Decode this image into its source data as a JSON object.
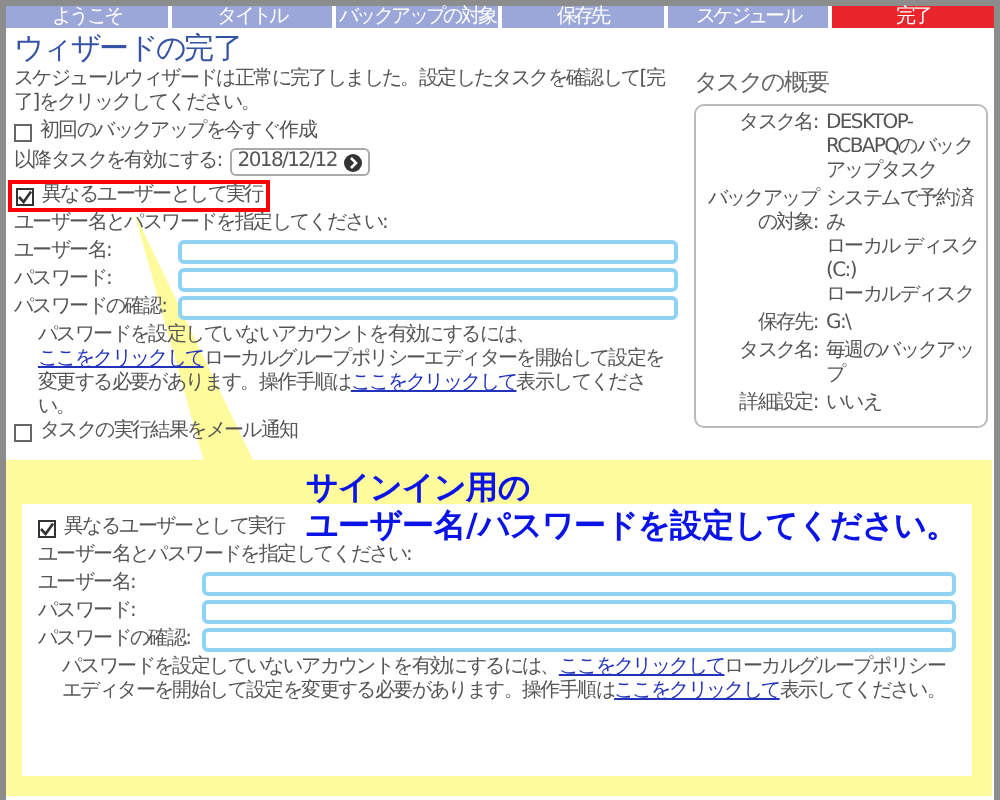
{
  "tabs": [
    {
      "label": "ようこそ",
      "selected": false
    },
    {
      "label": "タイトル",
      "selected": false
    },
    {
      "label": "バックアップの対象",
      "selected": false
    },
    {
      "label": "保存先",
      "selected": false
    },
    {
      "label": "スケジュール",
      "selected": false
    },
    {
      "label": "完了",
      "selected": true
    }
  ],
  "title": "ウィザードの完了",
  "intro": "スケジュールウィザードは正常に完了しました。設定したタスクを確認して[完了]をクリックしてください。",
  "backup_now": {
    "label": "初回のバックアップを今すぐ作成",
    "checked": false
  },
  "enable_after": {
    "label": "以降タスクを有効にする:",
    "value": "2018/12/12"
  },
  "run_as": {
    "label": "異なるユーザーとして実行",
    "checked": true,
    "highlighted": true
  },
  "hint": "ユーザー名とパスワードを指定してください:",
  "fields": [
    {
      "label": "ユーザー名:"
    },
    {
      "label": "パスワード:"
    },
    {
      "label": "パスワードの確認:"
    }
  ],
  "note": [
    {
      "text": "パスワードを設定していないアカウントを有効にするには、",
      "link": false
    },
    {
      "text": "ここをクリックして",
      "link": true
    },
    {
      "text": "ローカルグループポリシーエディターを開始して設定を変更する必要があります。操作手順は",
      "link": false
    },
    {
      "text": "ここをクリックして",
      "link": true
    },
    {
      "text": "表示してください。",
      "link": false
    }
  ],
  "mail_notify": {
    "label": "タスクの実行結果をメール通知",
    "checked": false
  },
  "summary": {
    "title": "タスクの概要",
    "rows": [
      {
        "label": "タスク名:",
        "values": [
          "DESKTOP-RCBAPQのバックアップタスク"
        ]
      },
      {
        "label": "バックアップの対象:",
        "values": [
          "システムで予約済み",
          "ローカル ディスク (C:)",
          "ローカルディスク"
        ]
      },
      {
        "label": "保存先:",
        "values": [
          "G:\\"
        ]
      },
      {
        "label": "タスク名:",
        "values": [
          "毎週のバックアップ"
        ]
      },
      {
        "label": "詳細設定:",
        "values": [
          "いいえ"
        ]
      }
    ]
  },
  "callout": {
    "lines": [
      "サインイン用の",
      "ユーザー名/パスワードを設定してください。"
    ],
    "run_as": {
      "label": "異なるユーザーとして実行",
      "checked": true
    },
    "hint": "ユーザー名とパスワードを指定してください:",
    "fields": [
      {
        "label": "ユーザー名:"
      },
      {
        "label": "パスワード:"
      },
      {
        "label": "パスワードの確認:"
      }
    ],
    "note": [
      {
        "text": "パスワードを設定していないアカウントを有効にするには、",
        "link": false
      },
      {
        "text": "ここをクリックして",
        "link": true
      },
      {
        "text": "ローカルグループポリシーエディターを開始して設定を変更する必要があります。操作手順は",
        "link": false
      },
      {
        "text": "ここをクリックして",
        "link": true
      },
      {
        "text": "表示してください。",
        "link": false
      }
    ]
  }
}
